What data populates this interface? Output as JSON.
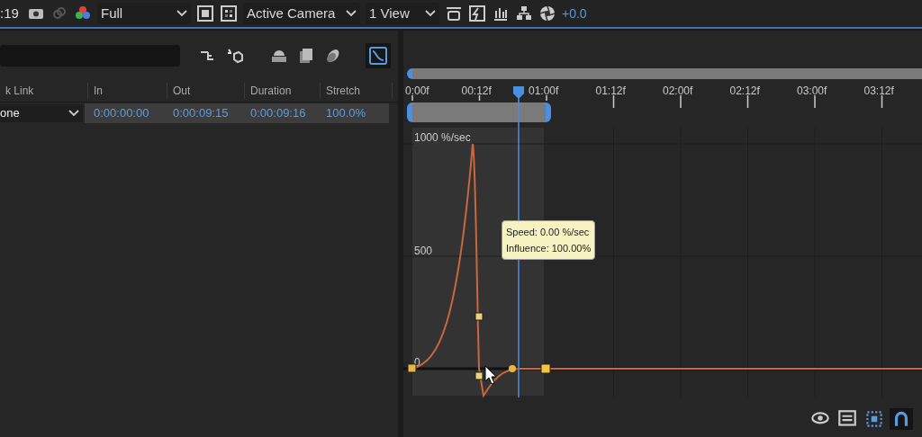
{
  "toolbar": {
    "timecode": ":19",
    "resolution": "Full",
    "view": "Active Camera",
    "layout": "1 View",
    "exposure": "+0.0"
  },
  "layer_panel": {
    "graph_editor_selected": true,
    "columns": [
      "k Link",
      "In",
      "Out",
      "Duration",
      "Stretch"
    ],
    "row": {
      "link": "one",
      "in": "0:00:00:00",
      "out": "0:00:09:15",
      "duration": "0:00:09:16",
      "stretch": "100.0%"
    }
  },
  "graph": {
    "ruler": [
      "0:00f",
      "00:12f",
      "01:00f",
      "01:12f",
      "02:00f",
      "02:12f",
      "03:00f",
      "03:12f"
    ],
    "axis_labels": [
      "1000 %/sec",
      "500",
      "0"
    ],
    "tooltip": [
      "Speed: 0.00 %/sec",
      "Influence: 100.00%"
    ],
    "bottom_tools": [
      {
        "kind": "eye",
        "selected": false
      },
      {
        "kind": "panel",
        "selected": false
      },
      {
        "kind": "transform-box",
        "selected": true
      },
      {
        "kind": "snap",
        "selected": true
      }
    ]
  }
}
